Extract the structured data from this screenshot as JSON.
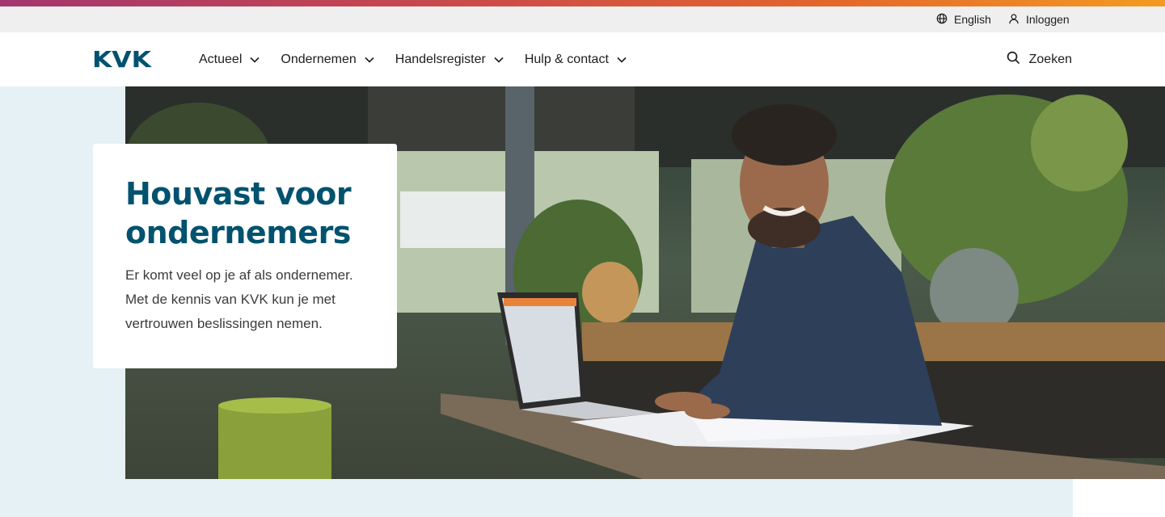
{
  "utility": {
    "language_label": "English",
    "login_label": "Inloggen"
  },
  "header": {
    "logo_text": "KVK",
    "nav": [
      {
        "label": "Actueel"
      },
      {
        "label": "Ondernemen"
      },
      {
        "label": "Handelsregister"
      },
      {
        "label": "Hulp & contact"
      }
    ],
    "search_label": "Zoeken"
  },
  "hero": {
    "title_line1": "Houvast voor",
    "title_line2": "ondernemers",
    "text": "Er komt veel op je af als ondernemer. Met de kennis van KVK kun je met vertrouwen beslissingen nemen."
  },
  "colors": {
    "brand": "#00526e",
    "hero_background": "#e6f1f5",
    "utility_bar": "#efefef",
    "top_gradient_start": "#a4366f",
    "top_gradient_end": "#f49b22"
  },
  "icons": {
    "language": "globe-icon",
    "login": "user-icon",
    "dropdown": "chevron-down-icon",
    "search": "search-icon"
  }
}
